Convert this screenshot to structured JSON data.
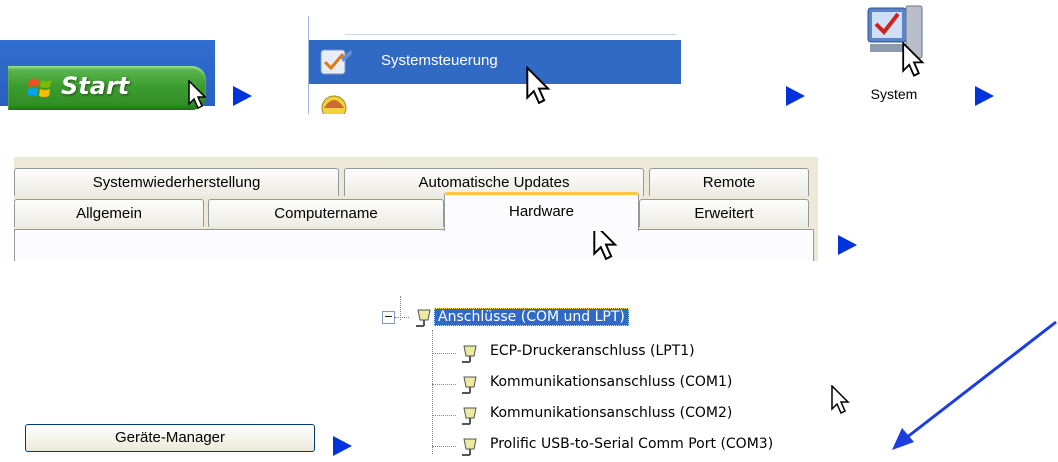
{
  "step1": {
    "start_label": "Start"
  },
  "step2": {
    "menu_item_label": "Systemsteuerung"
  },
  "step3": {
    "icon_label": "System"
  },
  "step4": {
    "tabs_row1": [
      "Systemwiederherstellung",
      "Automatische Updates",
      "Remote"
    ],
    "tabs_row2": [
      "Allgemein",
      "Computername",
      "Hardware",
      "Erweitert"
    ]
  },
  "step5": {
    "button_label": "Geräte-Manager"
  },
  "step6": {
    "category": "Anschlüsse (COM und LPT)",
    "ports": [
      "ECP-Druckeranschluss (LPT1)",
      "Kommunikationsanschluss (COM1)",
      "Kommunikationsanschluss (COM2)",
      "Prolific USB-to-Serial Comm Port (COM3)"
    ],
    "collapse_symbol": "−"
  },
  "colors": {
    "arrow": "#0033dd",
    "selection": "#316ac5",
    "start_green": "#3c9e2f"
  }
}
